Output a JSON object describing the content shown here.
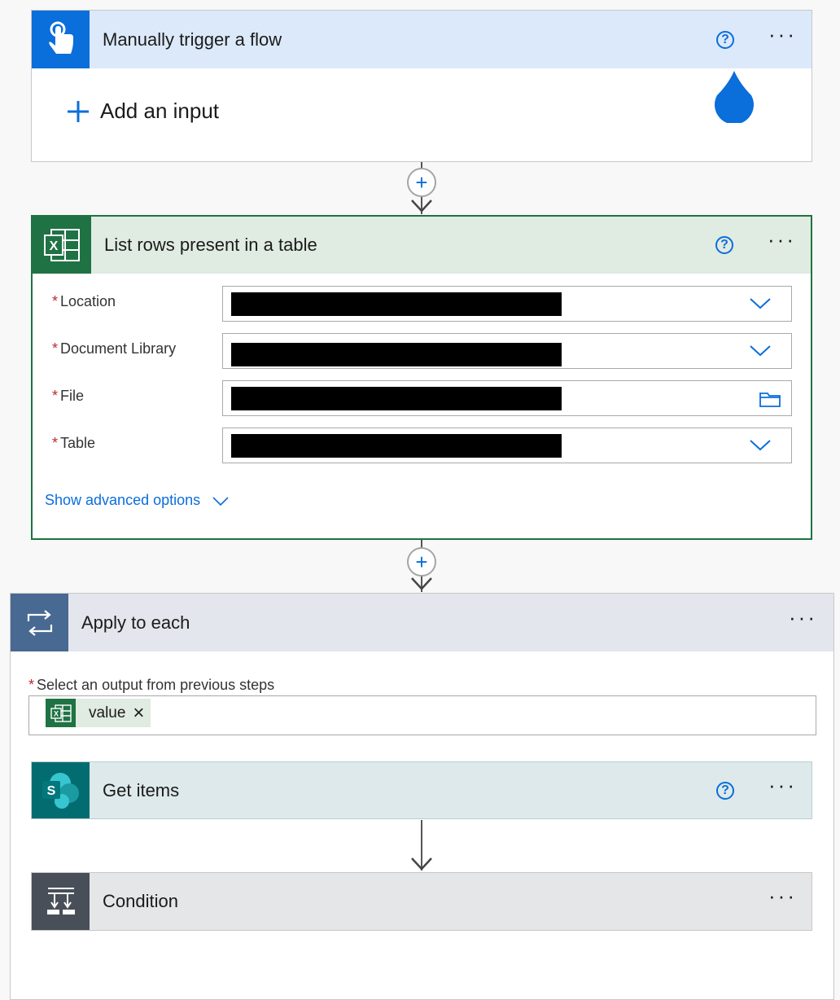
{
  "trigger": {
    "title": "Manually trigger a flow",
    "add_input": "Add an input",
    "help": "?",
    "more": "···",
    "icon": "touch-hand-icon",
    "color": "#0a6edb"
  },
  "list_rows": {
    "title": "List rows present in a table",
    "help": "?",
    "more": "···",
    "icon": "excel-icon",
    "color": "#1f7244",
    "fields": [
      {
        "label": "Location",
        "required": "*",
        "control": "dropdown"
      },
      {
        "label": "Document Library",
        "required": "*",
        "control": "dropdown"
      },
      {
        "label": "File",
        "required": "*",
        "control": "file-picker"
      },
      {
        "label": "Table",
        "required": "*",
        "control": "dropdown"
      }
    ],
    "advanced": "Show advanced options"
  },
  "apply_each": {
    "title": "Apply to each",
    "more": "···",
    "icon": "loop-icon",
    "color": "#486991",
    "select_label": "Select an output from previous steps",
    "required": "*",
    "token": "value",
    "token_remove": "×"
  },
  "get_items": {
    "title": "Get items",
    "help": "?",
    "more": "···",
    "icon": "sharepoint-icon",
    "color": "#036c70"
  },
  "condition": {
    "title": "Condition",
    "more": "···",
    "icon": "condition-icon",
    "color": "#484f58"
  },
  "add_step": "+"
}
